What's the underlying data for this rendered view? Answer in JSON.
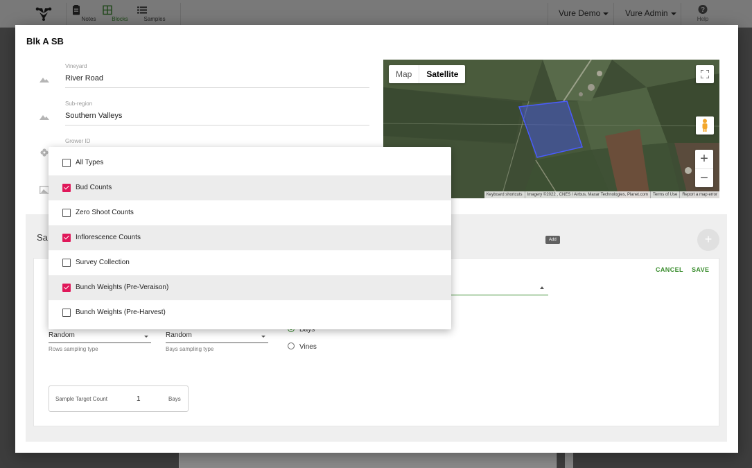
{
  "topbar": {
    "nav": [
      {
        "label": "Notes",
        "icon": "clipboard-icon"
      },
      {
        "label": "Blocks",
        "icon": "grid-icon",
        "active": true
      },
      {
        "label": "Samples",
        "icon": "list-icon"
      }
    ],
    "account_menu": "Vure Demo",
    "user_menu": "Vure Admin",
    "help_label": "Help"
  },
  "modal": {
    "title": "Blk A SB",
    "fields": [
      {
        "label": "Vineyard",
        "value": "River Road",
        "icon": "terrain-icon"
      },
      {
        "label": "Sub-region",
        "value": "Southern Valleys",
        "icon": "terrain-icon"
      },
      {
        "label": "Grower ID",
        "value": "",
        "icon": "flower-icon"
      }
    ],
    "map": {
      "types": [
        "Map",
        "Satellite"
      ],
      "selected_type": "Satellite",
      "attribution": [
        "Keyboard shortcuts",
        "Imagery ©2022 , CNES / Airbus, Maxar Technologies, Planet.com",
        "Terms of Use",
        "Report a map error"
      ],
      "polygon_color": "#3f4fd8"
    },
    "sampling": {
      "title_partial": "Sa",
      "add_tooltip": "Add",
      "add_button": "+",
      "cancel_label": "CANCEL",
      "save_label": "SAVE",
      "rows_sampling": {
        "value": "Random",
        "helper": "Rows sampling type"
      },
      "bays_sampling": {
        "value": "Random",
        "helper": "Bays sampling type"
      },
      "radio_options": [
        {
          "label": "Bays",
          "selected": true
        },
        {
          "label": "Vines",
          "selected": false
        }
      ],
      "target_count": {
        "label": "Sample Target Count",
        "value": "1",
        "unit": "Bays"
      }
    }
  },
  "dropdown": {
    "options": [
      {
        "label": "All Types",
        "checked": false
      },
      {
        "label": "Bud Counts",
        "checked": true
      },
      {
        "label": "Zero Shoot Counts",
        "checked": false
      },
      {
        "label": "Inflorescence Counts",
        "checked": true
      },
      {
        "label": "Survey Collection",
        "checked": false
      },
      {
        "label": "Bunch Weights (Pre-Veraison)",
        "checked": true
      },
      {
        "label": "Bunch Weights (Pre-Harvest)",
        "checked": false
      }
    ]
  },
  "colors": {
    "accent_green": "#3a8d2e",
    "checkbox_pink": "#e0185a"
  }
}
